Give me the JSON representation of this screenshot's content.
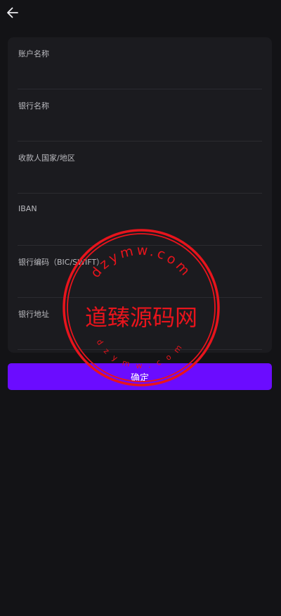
{
  "header": {
    "back_icon": "arrow-left-icon"
  },
  "form": {
    "fields": [
      {
        "label": "账户名称",
        "value": ""
      },
      {
        "label": "银行名称",
        "value": ""
      },
      {
        "label": "收款人国家/地区",
        "value": ""
      },
      {
        "label": "IBAN",
        "value": ""
      },
      {
        "label": "银行编码（BIC/SWIFT）",
        "value": ""
      },
      {
        "label": "银行地址",
        "value": ""
      }
    ]
  },
  "confirm_button": {
    "label": "确定",
    "color": "#6b0cff"
  },
  "watermark": {
    "text": "道臻源码网",
    "url": "dzymw.com",
    "color": "#e8141c"
  },
  "colors": {
    "background": "#131316",
    "card": "#1b1b1f",
    "divider": "#2b2b30"
  }
}
